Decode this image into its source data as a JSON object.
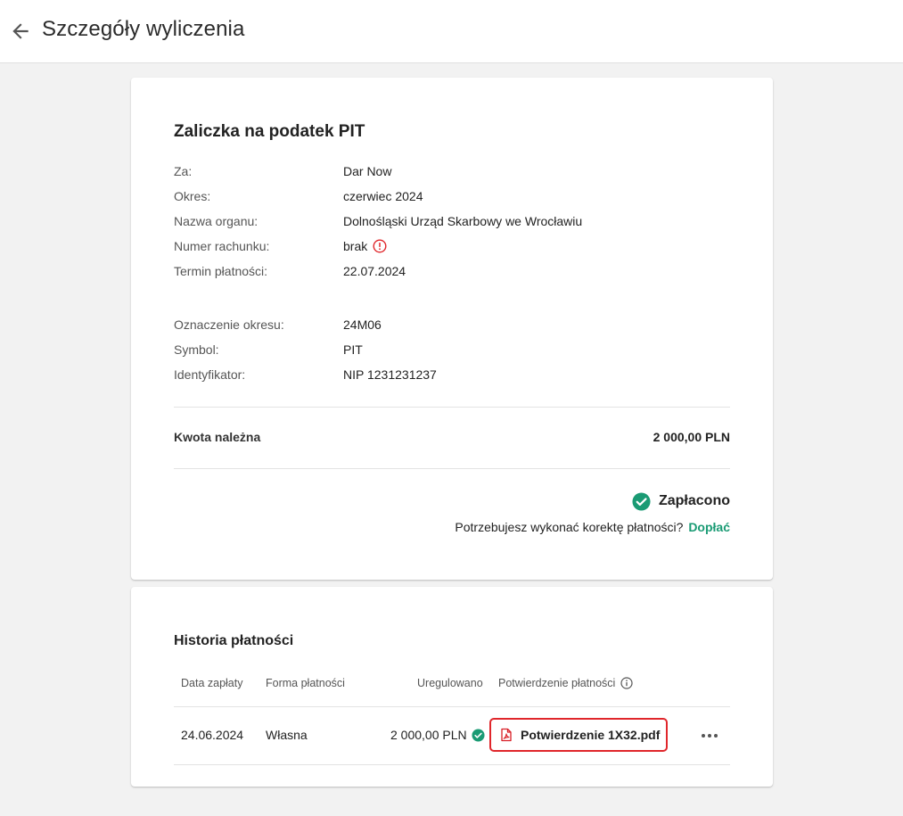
{
  "header": {
    "title": "Szczegóły wyliczenia"
  },
  "summary": {
    "title": "Zaliczka na podatek PIT",
    "details": [
      {
        "label": "Za:",
        "value": "Dar Now"
      },
      {
        "label": "Okres:",
        "value": "czerwiec 2024"
      },
      {
        "label": "Nazwa organu:",
        "value": "Dolnośląski Urząd Skarbowy we Wrocławiu"
      },
      {
        "label": "Numer rachunku:",
        "value": "brak"
      },
      {
        "label": "Termin płatności:",
        "value": "22.07.2024"
      }
    ],
    "extra": [
      {
        "label": "Oznaczenie okresu:",
        "value": "24M06"
      },
      {
        "label": "Symbol:",
        "value": "PIT"
      },
      {
        "label": "Identyfikator:",
        "value": "NIP 1231231237"
      }
    ],
    "amount_label": "Kwota należna",
    "amount_value": "2 000,00 PLN",
    "status": "Zapłacono",
    "correction_question": "Potrzebujesz wykonać korektę płatności?",
    "correction_link": "Dopłać"
  },
  "history": {
    "title": "Historia płatności",
    "columns": [
      "Data zapłaty",
      "Forma płatności",
      "Uregulowano",
      "Potwierdzenie płatności"
    ],
    "rows": [
      {
        "date": "24.06.2024",
        "form": "Własna",
        "amount": "2 000,00 PLN",
        "confirmation": "Potwierdzenie 1X32.pdf"
      }
    ]
  },
  "colors": {
    "accent": "#1a9b74",
    "warning": "#e0262b"
  },
  "icons": {
    "back": "arrow-left-icon",
    "warning": "exclamation-circle-icon",
    "paid": "check-circle-icon",
    "info": "info-icon",
    "pdf": "pdf-file-icon",
    "more": "more-horizontal-icon"
  }
}
